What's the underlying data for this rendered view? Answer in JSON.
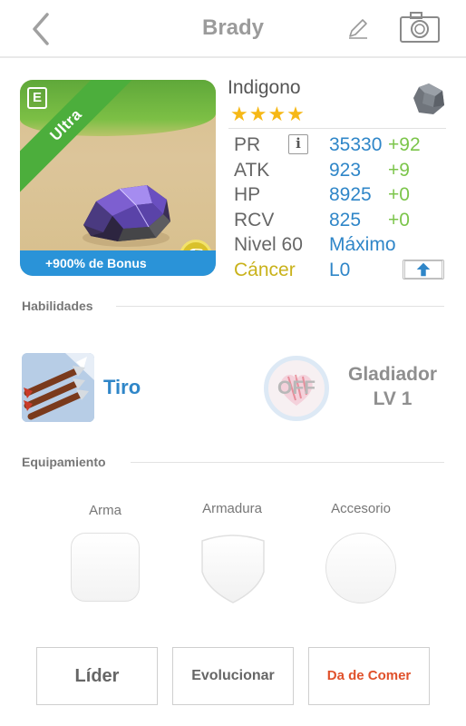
{
  "header": {
    "title": "Brady"
  },
  "card": {
    "rarity": "Ultra",
    "bonus": "+900% de Bonus",
    "badge_letter": "E"
  },
  "monster": {
    "name": "Indigono",
    "stars": "★★★★",
    "stats": {
      "pr": {
        "label": "PR",
        "value": "35330",
        "bonus": "+92"
      },
      "atk": {
        "label": "ATK",
        "value": "923",
        "bonus": "+9"
      },
      "hp": {
        "label": "HP",
        "value": "8925",
        "bonus": "+0"
      },
      "rcv": {
        "label": "RCV",
        "value": "825",
        "bonus": "+0"
      },
      "level": {
        "label": "Nivel 60",
        "value": "Máximo"
      },
      "sign": {
        "label": "Cáncer",
        "value": "L0"
      }
    },
    "info_glyph": "i"
  },
  "skills_section": {
    "label": "Habilidades",
    "skill": {
      "name": "Tiro"
    },
    "passive": {
      "state": "OFF",
      "name": "Gladiador",
      "level": "LV 1"
    }
  },
  "equip_section": {
    "label": "Equipamiento",
    "slots": [
      {
        "label": "Arma"
      },
      {
        "label": "Armadura"
      },
      {
        "label": "Accesorio"
      }
    ]
  },
  "actions": {
    "leader": "Líder",
    "evolve": "Evolucionar",
    "feed": "Da de Comer"
  },
  "colors": {
    "accent_blue": "#2f86c8",
    "bonus_green": "#7cc54b",
    "star_gold": "#f6b816",
    "cancer_yellow": "#c9b21b",
    "feed_red": "#e0512b",
    "ribbon_green": "#4cae3c",
    "bonus_bar_blue": "#2a93d8"
  },
  "icons": {
    "back": "chevron-left-icon",
    "edit": "pencil-icon",
    "camera": "camera-icon",
    "element": "stone-gem-icon",
    "info": "info-icon",
    "upgrade": "arrow-up-icon",
    "zodiac": "cancer-zodiac-icon"
  }
}
